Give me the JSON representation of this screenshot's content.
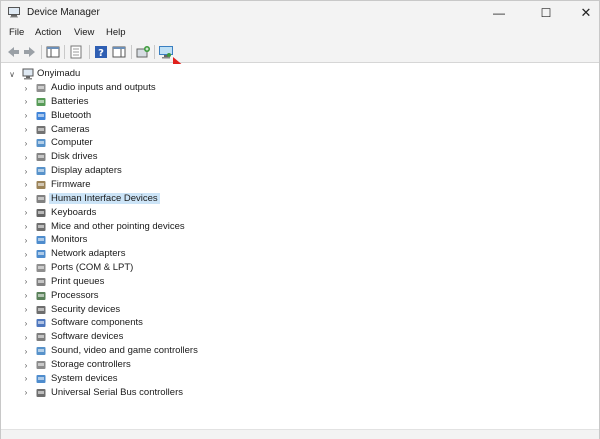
{
  "window": {
    "title": "Device Manager",
    "controls": {
      "minimize": "—",
      "maximize": "☐",
      "close": "✕"
    }
  },
  "menu": {
    "items": [
      "File",
      "Action",
      "View",
      "Help"
    ]
  },
  "toolbar": {
    "buttons": [
      "back-icon",
      "forward-icon",
      "show-hide-console-tree-icon",
      "properties-icon",
      "help-icon",
      "action-pane-icon",
      "update-driver-icon",
      "scan-hardware-icon"
    ]
  },
  "tree": {
    "root": "Onyimadu",
    "categories": [
      "Audio inputs and outputs",
      "Batteries",
      "Bluetooth",
      "Cameras",
      "Computer",
      "Disk drives",
      "Display adapters",
      "Firmware",
      "Human Interface Devices",
      "Keyboards",
      "Mice and other pointing devices",
      "Monitors",
      "Network adapters",
      "Ports (COM & LPT)",
      "Print queues",
      "Processors",
      "Security devices",
      "Software components",
      "Software devices",
      "Sound, video and game controllers",
      "Storage controllers",
      "System devices",
      "Universal Serial Bus controllers"
    ],
    "selected": "Human Interface Devices"
  },
  "colors": {
    "chrome": "#f3f3f3",
    "selection": "#cce4f7",
    "annotation_arrow": "#e0201c"
  }
}
